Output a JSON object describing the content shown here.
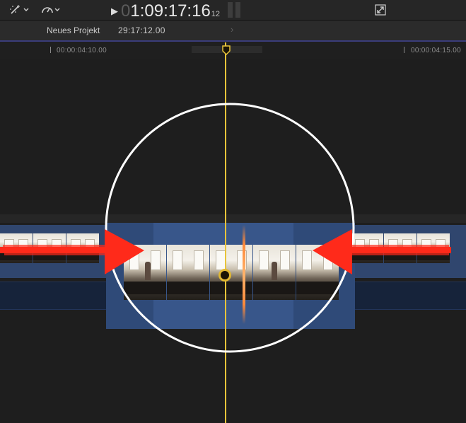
{
  "toolbar": {
    "tools_icon": "magic-wand-icon",
    "speed_icon": "speedometer-icon",
    "play_icon": "play-icon",
    "timecode_dim": "0",
    "timecode_main": "1:09:17:16",
    "timecode_frames": "12",
    "expand_icon": "expand-icon"
  },
  "project": {
    "name": "Neues Projekt",
    "duration": "29:17:12.00",
    "nav_icon": "chevron-right-icon"
  },
  "ruler": {
    "labels": [
      "00:00:04:10.00",
      "00:00:04:15.00"
    ]
  },
  "annotation": {
    "circle_color": "#ffffff",
    "arrow_color": "#ff2a1a"
  },
  "colors": {
    "playhead": "#e8c43a",
    "clip": "#30466e",
    "skimmer": "#ff8a3a"
  }
}
